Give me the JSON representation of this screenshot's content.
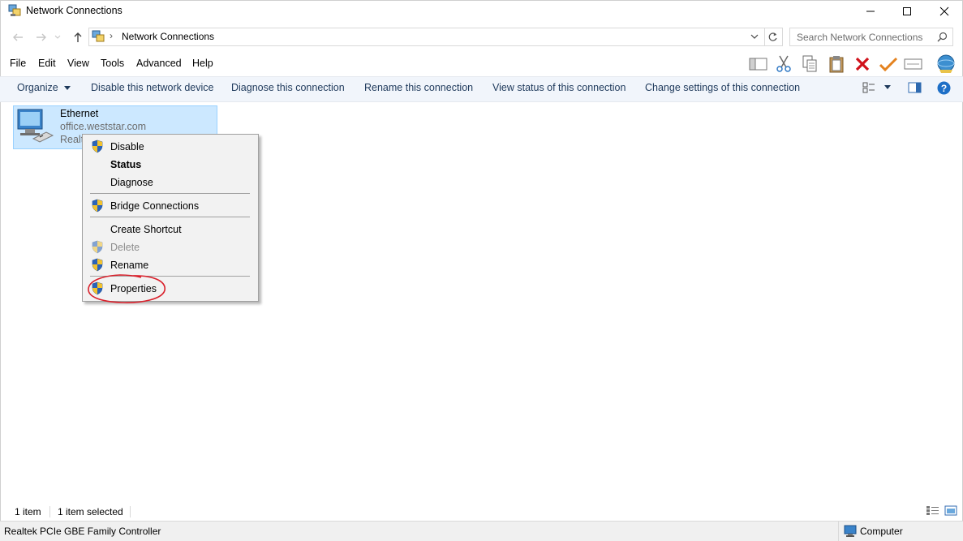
{
  "window": {
    "title": "Network Connections",
    "minimize_icon": "minimize-icon",
    "maximize_icon": "maximize-icon",
    "close_icon": "close-icon"
  },
  "address": {
    "breadcrumb": "Network Connections",
    "search_placeholder": "Search Network Connections"
  },
  "menu": [
    "File",
    "Edit",
    "View",
    "Tools",
    "Advanced",
    "Help"
  ],
  "commands": {
    "organize": "Organize",
    "disable": "Disable this network device",
    "diagnose": "Diagnose this connection",
    "rename": "Rename this connection",
    "view_status": "View status of this connection",
    "change_settings": "Change settings of this connection"
  },
  "item": {
    "name": "Ethernet",
    "network": "office.weststar.com",
    "adapter_truncated": "Realt"
  },
  "context_menu": {
    "disable": "Disable",
    "status": "Status",
    "diagnose": "Diagnose",
    "bridge": "Bridge Connections",
    "create_shortcut": "Create Shortcut",
    "delete": "Delete",
    "rename": "Rename",
    "properties": "Properties",
    "highlight_color": "#d9202b"
  },
  "status": {
    "count": "1 item",
    "selected": "1 item selected",
    "device": "Realtek PCIe GBE Family Controller",
    "zone": "Computer"
  },
  "colors": {
    "command_bar": "#f1f5fb",
    "selection": "#cce8ff",
    "command_text": "#1e395b"
  }
}
